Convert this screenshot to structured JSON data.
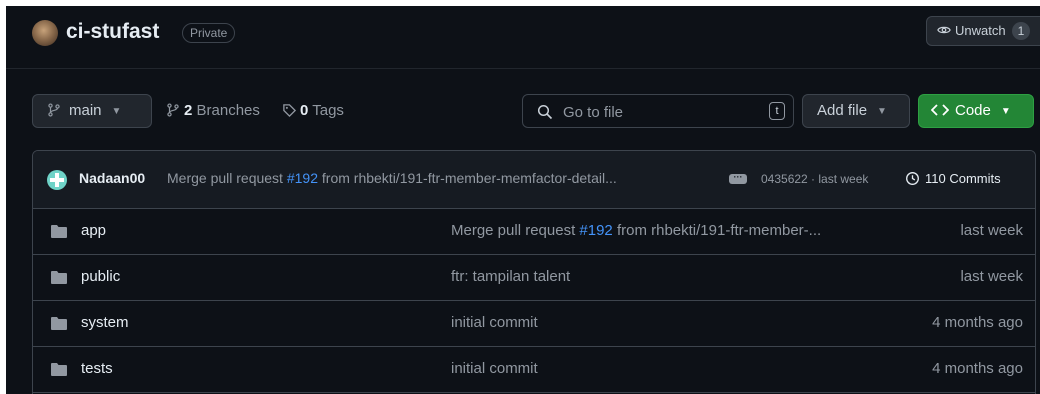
{
  "repo": {
    "name": "ci-stufast",
    "visibility": "Private",
    "unwatch_label": "Unwatch",
    "unwatch_count": "1"
  },
  "toolbar": {
    "branch": "main",
    "branches_count": "2",
    "branches_label": "Branches",
    "tags_count": "0",
    "tags_label": "Tags",
    "search_placeholder": "Go to file",
    "search_shortcut": "t",
    "add_file_label": "Add file",
    "code_label": "Code"
  },
  "latest_commit": {
    "author": "Nadaan00",
    "message_prefix": "Merge pull request ",
    "pr_link": "#192",
    "message_suffix": " from rhbekti/191-ftr-member-memfactor-detail...",
    "sha_and_time": "0435622 · last week",
    "commits_label": "110 Commits"
  },
  "files": [
    {
      "name": "app",
      "msg_prefix": "Merge pull request ",
      "msg_link": "#192",
      "msg_suffix": " from rhbekti/191-ftr-member-...",
      "time": "last week"
    },
    {
      "name": "public",
      "msg_prefix": "ftr: tampilan talent",
      "msg_link": "",
      "msg_suffix": "",
      "time": "last week"
    },
    {
      "name": "system",
      "msg_prefix": "initial commit",
      "msg_link": "",
      "msg_suffix": "",
      "time": "4 months ago"
    },
    {
      "name": "tests",
      "msg_prefix": "initial commit",
      "msg_link": "",
      "msg_suffix": "",
      "time": "4 months ago"
    }
  ],
  "colors": {
    "background": "#0d1117",
    "accent_green": "#238636",
    "link_blue": "#4493f8",
    "muted_text": "#9198a1"
  }
}
